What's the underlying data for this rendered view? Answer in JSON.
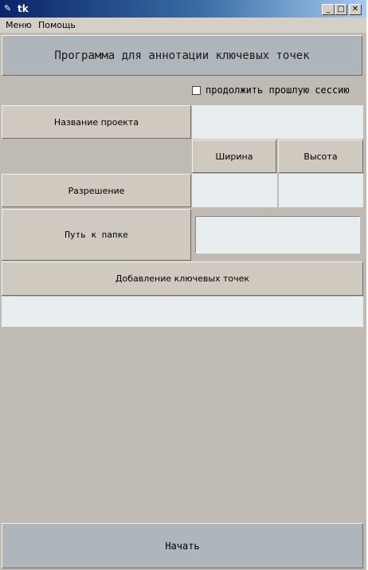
{
  "window": {
    "title": "tk"
  },
  "menubar": {
    "items": [
      "Меню",
      "Помощь"
    ]
  },
  "header": {
    "title": "Программа для аннотации ключевых точек"
  },
  "session": {
    "checkbox_label": "продолжить прошлую сессию",
    "checked": false
  },
  "form": {
    "project_name_label": "Название проекта",
    "project_name_value": "",
    "width_label": "Ширина",
    "height_label": "Высота",
    "resolution_label": "Разрешение",
    "resolution_width_value": "",
    "resolution_height_value": "",
    "folder_path_label": "Путь к папке",
    "folder_path_value": "",
    "keypoints_label": "Добавление ключевых точек",
    "keypoints_value": ""
  },
  "actions": {
    "start_label": "Начать"
  }
}
